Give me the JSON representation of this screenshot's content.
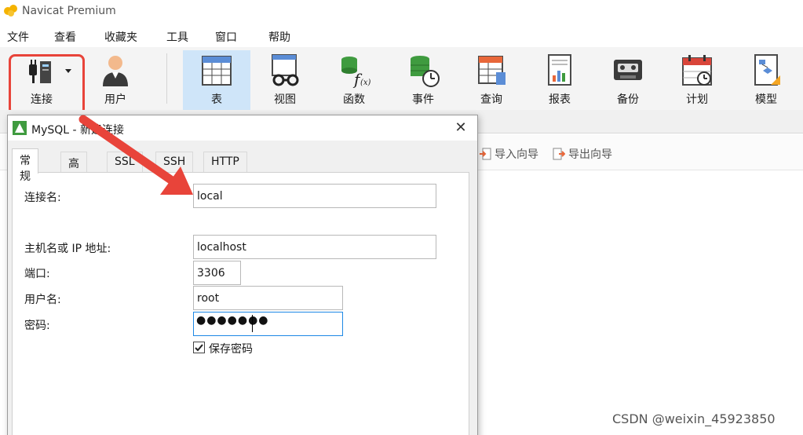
{
  "window": {
    "title": "Navicat Premium"
  },
  "menu": {
    "items": [
      "文件",
      "查看",
      "收藏夹",
      "工具",
      "窗口",
      "帮助"
    ]
  },
  "toolbar": {
    "buttons": [
      {
        "label": "连接",
        "icon": "plug-icon",
        "dropdown": true,
        "highlighted": true
      },
      {
        "label": "用户",
        "icon": "user-icon"
      },
      {
        "label": "表",
        "icon": "table-icon",
        "active": true
      },
      {
        "label": "视图",
        "icon": "view-icon"
      },
      {
        "label": "函数",
        "icon": "function-icon"
      },
      {
        "label": "事件",
        "icon": "event-icon"
      },
      {
        "label": "查询",
        "icon": "query-icon"
      },
      {
        "label": "报表",
        "icon": "report-icon"
      },
      {
        "label": "备份",
        "icon": "backup-icon"
      },
      {
        "label": "计划",
        "icon": "schedule-icon"
      },
      {
        "label": "模型",
        "icon": "model-icon"
      }
    ]
  },
  "object_bar": {
    "import": "导入向导",
    "export": "导出向导"
  },
  "dialog": {
    "title": "MySQL - 新建连接",
    "close": "✕",
    "tabs": [
      "常规",
      "高级",
      "SSL",
      "SSH",
      "HTTP"
    ],
    "active_tab": "常规",
    "fields": {
      "connection_name": {
        "label": "连接名:",
        "value": "local"
      },
      "host": {
        "label": "主机名或 IP 地址:",
        "value": "localhost"
      },
      "port": {
        "label": "端口:",
        "value": "3306"
      },
      "username": {
        "label": "用户名:",
        "value": "root"
      },
      "password": {
        "label": "密码:",
        "masked": "●●●●●●●"
      }
    },
    "save_password": {
      "label": "保存密码",
      "checked": true
    }
  },
  "annotation": {
    "color": "#e8443a"
  },
  "watermark": "CSDN @weixin_45923850",
  "colors": {
    "accent": "#1e88e5",
    "toolbar_active": "#cfe5f9",
    "highlight": "#e8443a"
  }
}
